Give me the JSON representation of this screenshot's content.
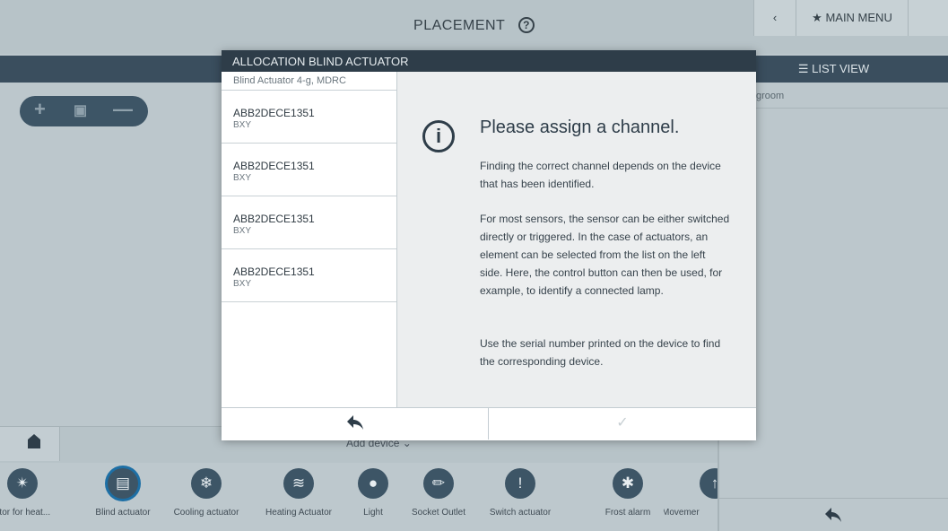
{
  "header": {
    "title": "PLACEMENT",
    "help_icon": "help-circle-icon",
    "back_icon": "chevron-left-icon",
    "main_menu_label": "MAIN MENU",
    "main_menu_icon": "star-icon"
  },
  "right_panel": {
    "list_view_label": "LIST VIEW",
    "list_view_icon": "list-icon",
    "room_label": "groom",
    "back_icon": "back-arrow-icon"
  },
  "zoom": {
    "zoom_in_icon": "plus-icon",
    "fit_icon": "fit-screen-icon",
    "zoom_out_icon": "minus-icon"
  },
  "bottom_bar": {
    "home_icon": "house-icon",
    "add_device_label": "Add device"
  },
  "palette": {
    "items": [
      {
        "label": "ator for heat...",
        "icon": "actuator-heat-icon"
      },
      {
        "label": "Blind actuator",
        "icon": "blind-icon"
      },
      {
        "label": "Cooling actuator",
        "icon": "snowflake-icon"
      },
      {
        "label": "Heating Actuator",
        "icon": "heat-icon"
      },
      {
        "label": "Light",
        "icon": "bulb-icon"
      },
      {
        "label": "Socket Outlet",
        "icon": "socket-icon"
      },
      {
        "label": "Switch actuator",
        "icon": "switch-icon"
      },
      {
        "label": "Frost alarm",
        "icon": "frost-icon"
      },
      {
        "label": "Movemer",
        "icon": "movement-icon"
      }
    ]
  },
  "dialog": {
    "title": "ALLOCATION BLIND ACTUATOR",
    "device_subtitle": "Blind Actuator 4-g, MDRC",
    "items": [
      {
        "name": "ABB2DECE1351",
        "sub": "BXY"
      },
      {
        "name": "ABB2DECE1351",
        "sub": "BXY"
      },
      {
        "name": "ABB2DECE1351",
        "sub": "BXY"
      },
      {
        "name": "ABB2DECE1351",
        "sub": "BXY"
      }
    ],
    "heading": "Please assign a channel.",
    "info_icon": "info-icon",
    "paragraphs": [
      "Finding the correct channel depends on the device that has been identified.",
      "For most sensors, the sensor can be either switched directly or triggered. In the case of actuators, an element can be selected from the list on the left side. Here, the control button can then be used, for example, to identify a connected lamp.",
      "Use the serial number printed on the device to find the corresponding device."
    ],
    "back_icon": "back-arrow-icon",
    "confirm_icon": "checkmark-icon"
  }
}
